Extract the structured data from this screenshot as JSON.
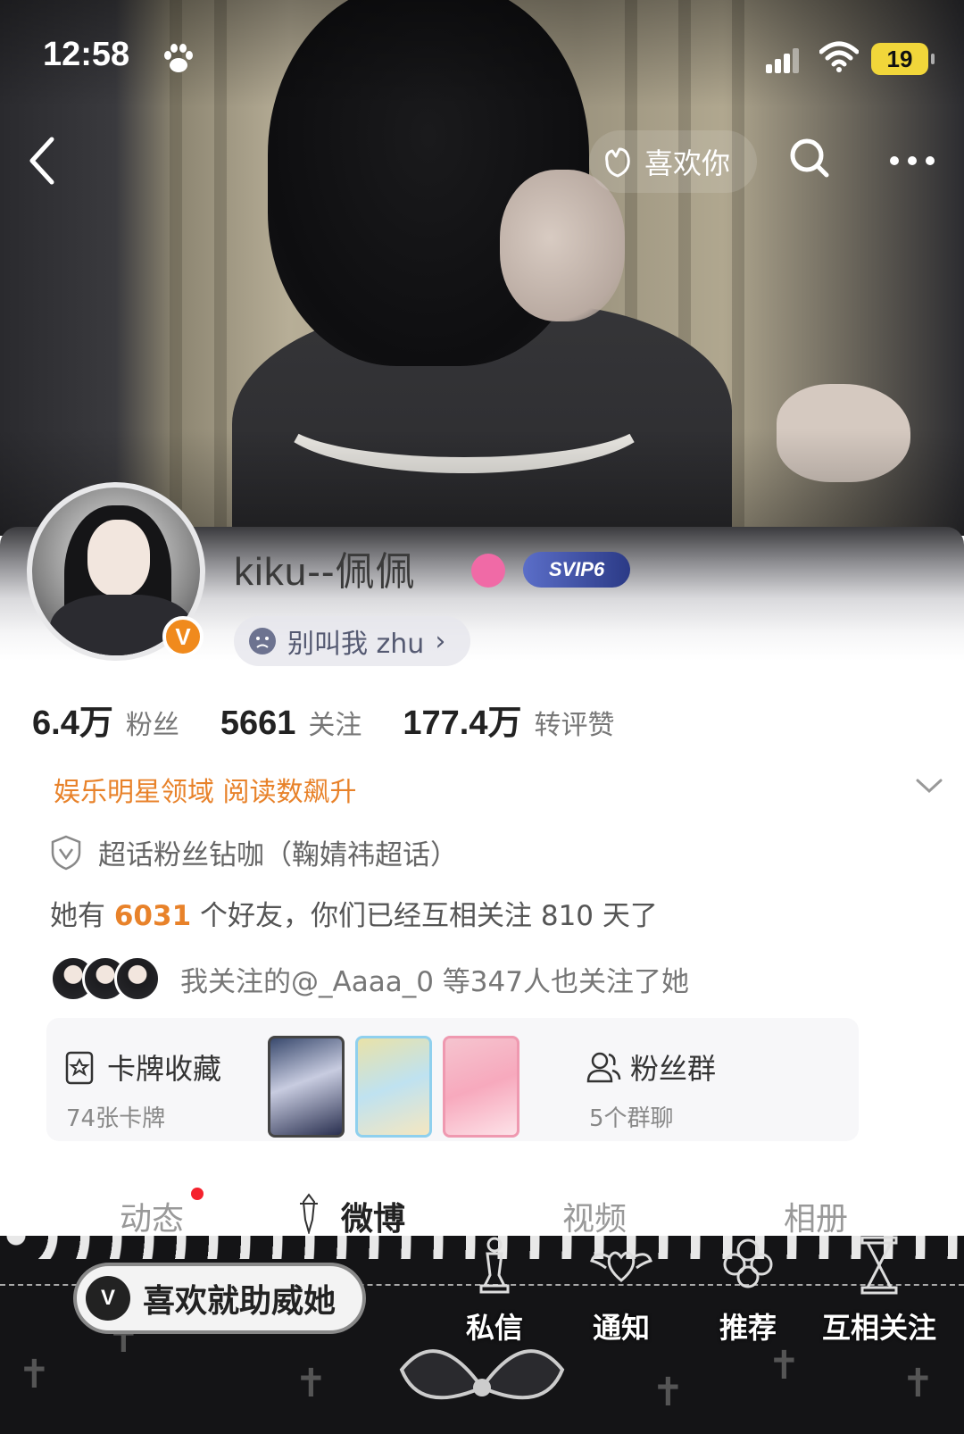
{
  "status_bar": {
    "time": "12:58",
    "battery": "19"
  },
  "nav": {
    "like_label": "喜欢你"
  },
  "profile": {
    "username": "kiku--佩佩",
    "vip_badge": "SVIP6",
    "verified_badge": "V",
    "signature": "别叫我 zhu",
    "stats": [
      {
        "value": "6.4万",
        "label": "粉丝"
      },
      {
        "value": "5661",
        "label": "关注"
      },
      {
        "value": "177.4万",
        "label": "转评赞"
      }
    ],
    "domain_tag": "娱乐明星领域 阅读数飙升",
    "fan_title": "超话粉丝钻咖（鞠婧祎超话）",
    "friends": {
      "prefix": "她有 ",
      "count": "6031",
      "suffix": " 个好友，你们已经互相关注 810 天了"
    },
    "mutual_follow": "我关注的@_Aaaa_0 等347人也关注了她"
  },
  "cards": {
    "title": "卡牌收藏",
    "subtitle": "74张卡牌",
    "group_title": "粉丝群",
    "group_subtitle": "5个群聊"
  },
  "tabs": [
    {
      "label": "动态",
      "active": false,
      "has_dot": true
    },
    {
      "label": "微博",
      "active": true
    },
    {
      "label": "视频",
      "active": false
    },
    {
      "label": "相册",
      "active": false
    }
  ],
  "bottom_bar": {
    "boost_logo": "V",
    "boost_label": "喜欢就助威她",
    "actions": [
      {
        "label": "私信",
        "icon": "chess-icon"
      },
      {
        "label": "通知",
        "icon": "winged-heart-icon"
      },
      {
        "label": "推荐",
        "icon": "clover-icon"
      },
      {
        "label": "互相关注",
        "icon": "hourglass-icon"
      }
    ]
  },
  "colors": {
    "accent_orange": "#e8822a",
    "red_dot": "#f5222d",
    "verified": "#f08a1d"
  }
}
